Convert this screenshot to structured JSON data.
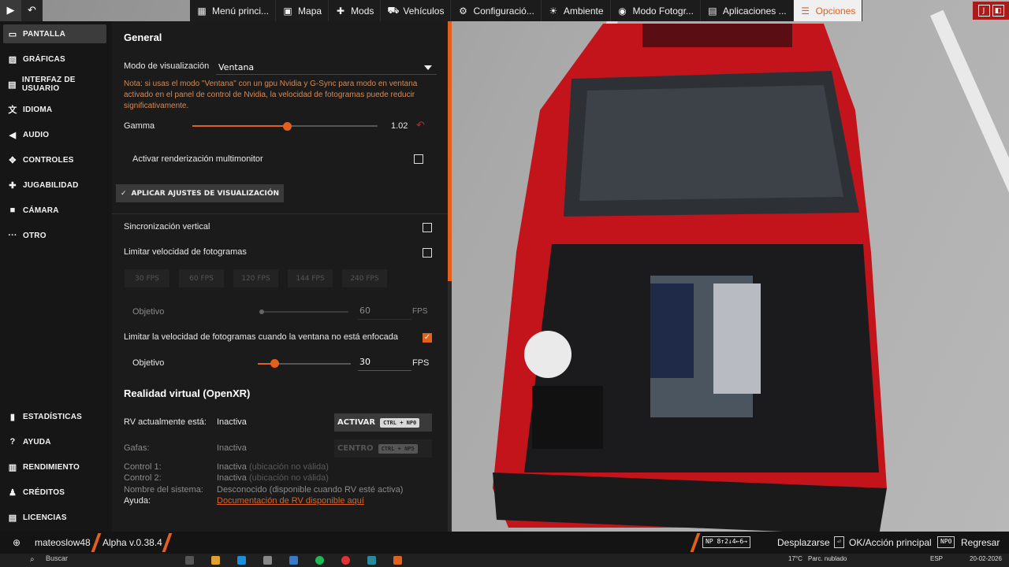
{
  "topbar": {
    "menu": [
      {
        "icon": "grid-icon",
        "glyph": "▦",
        "label": "Menú princi..."
      },
      {
        "icon": "map-icon",
        "glyph": "▣",
        "label": "Mapa"
      },
      {
        "icon": "puzzle-icon",
        "glyph": "✚",
        "label": "Mods"
      },
      {
        "icon": "car-icon",
        "glyph": "⛟",
        "label": "Vehículos"
      },
      {
        "icon": "config-icon",
        "glyph": "⚙",
        "label": "Configuració..."
      },
      {
        "icon": "environment-icon",
        "glyph": "☀",
        "label": "Ambiente"
      },
      {
        "icon": "camera-icon",
        "glyph": "◉",
        "label": "Modo Fotogr..."
      },
      {
        "icon": "apps-icon",
        "glyph": "▤",
        "label": "Aplicaciones ..."
      },
      {
        "icon": "options-icon",
        "glyph": "☰",
        "label": "Opciones"
      }
    ]
  },
  "sidebar": {
    "items": [
      {
        "icon": "monitor-icon",
        "glyph": "▭",
        "label": "PANTALLA"
      },
      {
        "icon": "image-icon",
        "glyph": "▨",
        "label": "GRÁFICAS"
      },
      {
        "icon": "ui-icon",
        "glyph": "▤",
        "label": "INTERFAZ DE USUARIO"
      },
      {
        "icon": "language-icon",
        "glyph": "文",
        "label": "IDIOMA"
      },
      {
        "icon": "audio-icon",
        "glyph": "◀",
        "label": "AUDIO"
      },
      {
        "icon": "gamepad-icon",
        "glyph": "✥",
        "label": "CONTROLES"
      },
      {
        "icon": "gameplay-icon",
        "glyph": "✚",
        "label": "JUGABILIDAD"
      },
      {
        "icon": "camera-icon",
        "glyph": "■",
        "label": "CÁMARA"
      },
      {
        "icon": "more-icon",
        "glyph": "···",
        "label": "OTRO"
      }
    ],
    "bottom_items": [
      {
        "icon": "stats-icon",
        "glyph": "▮",
        "label": "ESTADÍSTICAS"
      },
      {
        "icon": "help-icon",
        "glyph": "?",
        "label": "AYUDA"
      },
      {
        "icon": "performance-icon",
        "glyph": "▥",
        "label": "RENDIMIENTO"
      },
      {
        "icon": "credits-icon",
        "glyph": "♟",
        "label": "CRÉDITOS"
      },
      {
        "icon": "licenses-icon",
        "glyph": "▤",
        "label": "LICENCIAS"
      }
    ]
  },
  "general": {
    "title": "General",
    "display_mode_label": "Modo de visualización",
    "display_mode_value": "Ventana",
    "note": "Nota: si usas el modo \"Ventana\" con un gpu Nvidia y G-Sync para modo en ventana activado en el panel de control de Nvidia, la velocidad de fotogramas puede reducir significativamente.",
    "gamma_label": "Gamma",
    "gamma_value": "1.02",
    "gamma_fraction": 0.51,
    "multimonitor_label": "Activar renderización multimonitor",
    "multimonitor_checked": false,
    "apply_label": "APLICAR AJUSTES DE VISUALIZACIÓN",
    "vsync_label": "Sincronización vertical",
    "vsync_checked": false,
    "limit_fps_label": "Limitar velocidad de fotogramas",
    "limit_fps_checked": false,
    "fps_presets": [
      "30 FPS",
      "60 FPS",
      "120 FPS",
      "144 FPS",
      "240 FPS"
    ],
    "target_label_disabled": "Objetivo",
    "target_value_disabled": "60",
    "fps_unit": "FPS",
    "unfocused_label": "Limitar la velocidad de fotogramas cuando la ventana no está enfocada",
    "unfocused_checked": true,
    "target_label": "Objetivo",
    "target_value": "30",
    "target_fraction": 0.18
  },
  "vr": {
    "title": "Realidad virtual (OpenXR)",
    "status_label": "RV actualmente está:",
    "status_value": "Inactiva",
    "activate_label": "ACTIVAR",
    "activate_keys": "CTRL + NP0",
    "glasses_label": "Gafas:",
    "glasses_value": "Inactiva",
    "center_label": "CENTRO",
    "center_keys": "CTRL + NP5",
    "control1_label": "Control 1:",
    "control1_value": "Inactiva",
    "control1_note": "(ubicación no válida)",
    "control2_label": "Control 2:",
    "control2_value": "Inactiva",
    "control2_note": "(ubicación no válida)",
    "system_label": "Nombre del sistema:",
    "system_value": "Desconocido (disponible cuando RV esté activa)",
    "help_label": "Ayuda:",
    "help_link": "Documentación de RV disponible aquí"
  },
  "bottombar": {
    "username": "mateoslow48",
    "version": "Alpha v.0.38.4",
    "nav_keys": "NP 8↑2↓4←6→",
    "nav_label": "Desplazarse",
    "ok_key": "⏎",
    "ok_label": "OK/Acción principal",
    "back_key": "NP0",
    "back_label": "Regresar"
  },
  "taskbar": {
    "search_placeholder": "Buscar",
    "temperature": "17°C",
    "weather": "Parc. nublado",
    "lang": "ESP",
    "date": "20-02-2026"
  },
  "colors": {
    "accent": "#e2601d",
    "panel": "#1b1b1b",
    "sidebar": "#161616"
  }
}
